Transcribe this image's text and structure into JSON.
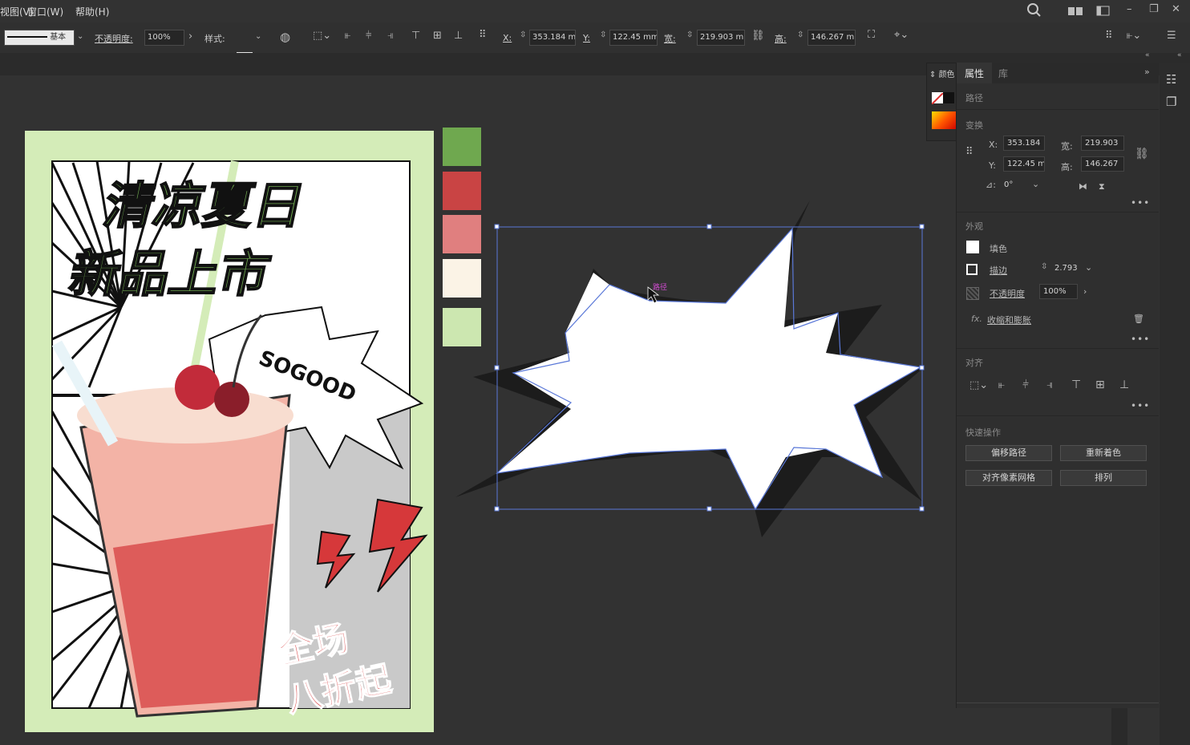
{
  "menu": {
    "view": "视图(V)",
    "window": "窗口(W)",
    "help": "帮助(H)"
  },
  "control_bar": {
    "stroke_style": "基本",
    "opacity_label": "不透明度:",
    "opacity_value": "100%",
    "style_label": "样式:",
    "x_label": "X:",
    "x_value": "353.184 m",
    "y_label": "Y:",
    "y_value": "122.45 mm",
    "w_label": "宽:",
    "w_value": "219.903 m",
    "h_label": "高:",
    "h_value": "146.267 m"
  },
  "swatches": [
    "#6fa84f",
    "#c94444",
    "#e07f7f",
    "#fbf3e6",
    "#cce7b0"
  ],
  "poster": {
    "title_line1": "清凉夏日",
    "title_line2": "新品上市",
    "sogood": "SOGOOD",
    "sale_line1": "全场",
    "sale_line2": "八折起",
    "bg_color": "#d4ecb8"
  },
  "canvas": {
    "cursor_label": "路径"
  },
  "color_panel": {
    "tab_label": "颜色"
  },
  "properties": {
    "tab_properties": "属性",
    "tab_library": "库",
    "object_type": "路径",
    "transform_head": "变换",
    "x_label": "X:",
    "x_value": "353.184",
    "y_label": "Y:",
    "y_value": "122.45 m",
    "w_label": "宽:",
    "w_value": "219.903",
    "h_label": "高:",
    "h_value": "146.267",
    "angle_value": "0°",
    "appearance_head": "外观",
    "fill_label": "填色",
    "stroke_label": "描边",
    "stroke_value": "2.793",
    "opacity_label": "不透明度",
    "opacity_value": "100%",
    "effect_label": "收缩和膨胀",
    "align_head": "对齐",
    "quick_head": "快速操作",
    "btn_offset": "偏移路径",
    "btn_recolor": "重新着色",
    "btn_pixel": "对齐像素网格",
    "btn_arrange": "排列"
  }
}
